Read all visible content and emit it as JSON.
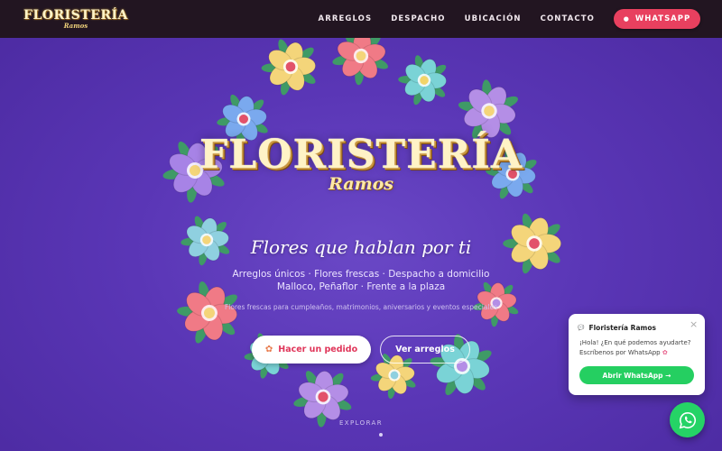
{
  "nav": {
    "brand_title": "FLORISTERÍA",
    "brand_sub": "Ramos",
    "links": [
      "ARREGLOS",
      "DESPACHO",
      "UBICACIÓN",
      "CONTACTO"
    ],
    "cta_label": "WHATSAPP",
    "cta_icon": "chat-bubble-icon"
  },
  "hero": {
    "title": "FLORISTERÍA",
    "subtitle": "Ramos",
    "tagline": "Flores que hablan por ti",
    "line1": "Arreglos únicos · Flores frescas · Despacho a domicilio",
    "line2": "Malloco, Peñaflor · Frente a la plaza",
    "small": "Flores frescas para cumpleaños, matrimonios, aniversarios y eventos especiales",
    "primary_button": "Hacer un pedido",
    "primary_icon": "bouquet-icon",
    "secondary_button": "Ver arreglos",
    "explore": "EXPLORAR"
  },
  "chat": {
    "title": "Floristería Ramos",
    "close": "×",
    "message": "¡Hola! ¿En qué podemos ayudarte? Escríbenos por WhatsApp",
    "message_emoji": "✿",
    "button": "Abrir WhatsApp →"
  },
  "colors": {
    "background": "#5a36b6",
    "nav": "#221521",
    "accent": "#e8405f",
    "whatsapp": "#25d366",
    "title_gold": "#fff3c6"
  }
}
